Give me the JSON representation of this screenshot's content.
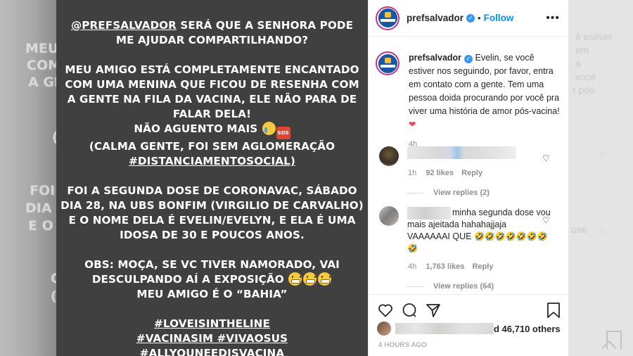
{
  "background": {
    "left_fragments": [
      "MEU",
      "COM",
      "A GEN",
      "(",
      "FOI",
      "DIA 2",
      "E O",
      "O",
      "(",
      "M"
    ],
    "right_fragments": [
      "ê estiver",
      "em",
      "a",
      "você",
      "r pós-",
      "ose"
    ]
  },
  "story": {
    "line1a": "@PREFSALVADOR",
    "line1b": " SERÁ QUE A SENHORA PODE",
    "line2": "ME AJUDAR COMPARTILHANDO?",
    "p2_l1": "MEU AMIGO ESTÁ COMPLETAMENTE ENCANTADO",
    "p2_l2": "COM UMA MENINA QUE FICOU DE RESENHA COM",
    "p2_l3": "A GENTE NA FILA DA VACINA, ELE NÃO PARA DE",
    "p2_l4": "FALAR DELA!",
    "p2_l5": "NÃO AGUENTO MAIS",
    "sos": "SOS",
    "p2_l6": "(CALMA GENTE, FOI SEM AGLOMERAÇÃO",
    "p2_l7": "#DISTANCIAMENTOSOCIAL)",
    "p3_l1": "FOI A SEGUNDA DOSE DE CORONAVAC, SÁBADO",
    "p3_l2": "DIA 28, NA UBS BONFIM (VIRGILIO DE CARVALHO)",
    "p3_l3": "E O NOME DELA É EVELIN/EVELYN, E ELA É UMA",
    "p3_l4": "IDOSA DE 30 E POUCOS ANOS.",
    "p4_l1": "OBS: MOÇA, SE VC TIVER NAMORADO, VAI",
    "p4_l2": "DESCULPANDO AÍ A EXPOSIÇÃO",
    "p4_l3": "MEU AMIGO É O “BAHIA”",
    "tag1": "#LOVEISINTHELINE",
    "tag2": "#VACINASIM #VIVAOSUS",
    "tag3": "#ALLYOUNEEDISVACINA"
  },
  "header": {
    "username": "prefsalvador",
    "separator": "•",
    "follow_label": "Follow",
    "more_label": "•••"
  },
  "caption": {
    "username": "prefsalvador",
    "text": "Evelin, se você estiver nos seguindo, por favor, entra em contato com a gente. Tem uma pessoa doida procurando por você pra viver uma história de amor pós-vacina!",
    "heart": "❤",
    "time": "4h"
  },
  "comments": [
    {
      "text": "",
      "time": "1h",
      "likes": "92 likes",
      "reply_label": "Reply",
      "view_replies": "View replies (2)"
    },
    {
      "text": "minha segunda dose vou mais ajeitada hahahajjaja VAAAAAAI QUE",
      "emojis": "🤣🤣🤣🤣🤣🤣🤣🤣",
      "time": "4h",
      "likes": "1,763 likes",
      "reply_label": "Reply",
      "view_replies": "View replies (64)"
    }
  ],
  "actions": {
    "likes_text": "d 46,710 others",
    "timestamp": "4 HOURS AGO"
  },
  "colors": {
    "story_bg": "#404040",
    "link_blue": "#0095f6",
    "verified_blue": "#3897f0",
    "heart_red": "#ed4956",
    "meta_gray": "#8e8e8e"
  }
}
